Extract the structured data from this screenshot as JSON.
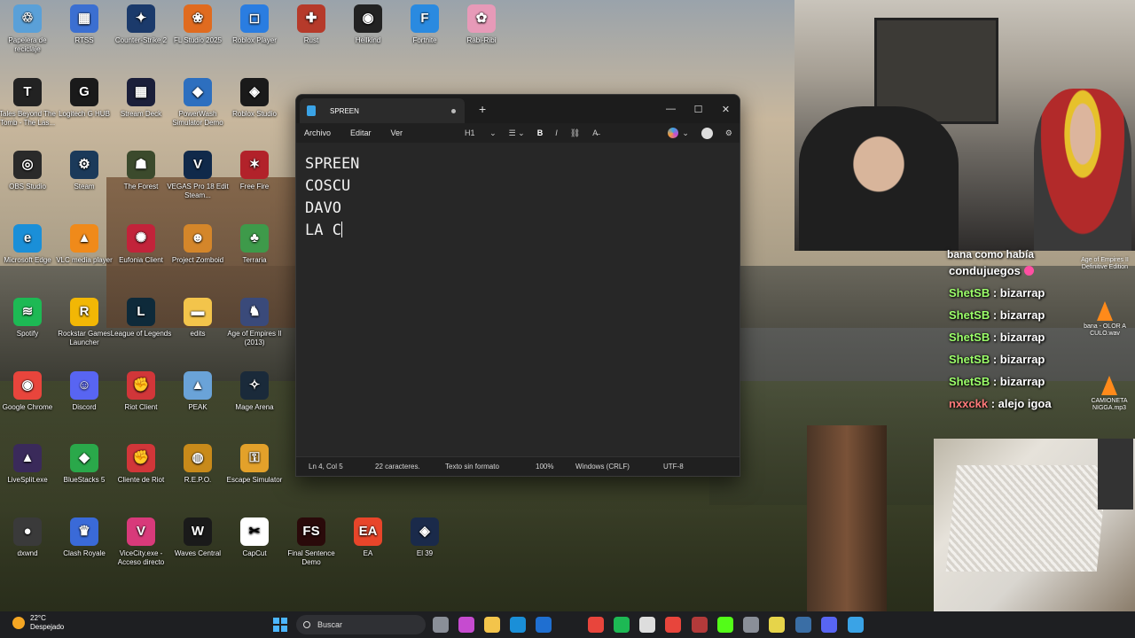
{
  "desktop_icons": [
    {
      "label": "Papelera de reciclaje",
      "icon": "recycle-bin-icon",
      "color": "#5aa0d8",
      "glyph": "♲"
    },
    {
      "label": "RTSS",
      "icon": "rtss-icon",
      "color": "#3b6fd1",
      "glyph": "▦"
    },
    {
      "label": "Counter-Strike 2",
      "icon": "counter-strike-icon",
      "color": "#1b3a6b",
      "glyph": "✦"
    },
    {
      "label": "FL Studio 2025",
      "icon": "fl-studio-icon",
      "color": "#e06b1f",
      "glyph": "❀"
    },
    {
      "label": "Roblox Player",
      "icon": "roblox-icon",
      "color": "#2a7de1",
      "glyph": "◻"
    },
    {
      "label": "Rust",
      "icon": "rust-icon",
      "color": "#b63a2a",
      "glyph": "✚"
    },
    {
      "label": "Hellkind",
      "icon": "hellkind-icon",
      "color": "#222222",
      "glyph": "◉"
    },
    {
      "label": "Fortnite",
      "icon": "fortnite-icon",
      "color": "#2a8ae0",
      "glyph": "F"
    },
    {
      "label": "Rabi-Ribi",
      "icon": "rabi-ribi-icon",
      "color": "#e79ab8",
      "glyph": "✿"
    },
    {
      "label": "Tales Beyond The Tomb - The Las...",
      "icon": "tbtt-icon",
      "color": "#222222",
      "glyph": "T"
    },
    {
      "label": "Logitech G HUB",
      "icon": "logitech-icon",
      "color": "#1a1a1a",
      "glyph": "G"
    },
    {
      "label": "Stream Deck",
      "icon": "stream-deck-icon",
      "color": "#1b1f3a",
      "glyph": "▦"
    },
    {
      "label": "PowerWash Simulator Demo",
      "icon": "powerwash-icon",
      "color": "#2d6fbf",
      "glyph": "◆"
    },
    {
      "label": "Roblox Studio",
      "icon": "roblox-studio-icon",
      "color": "#1a1a1a",
      "glyph": "◈"
    },
    {
      "label": "OBS Studio",
      "icon": "obs-icon",
      "color": "#2a2a2a",
      "glyph": "◎"
    },
    {
      "label": "Steam",
      "icon": "steam-icon",
      "color": "#1b3a5a",
      "glyph": "⚙"
    },
    {
      "label": "The Forest",
      "icon": "the-forest-icon",
      "color": "#3b4a2c",
      "glyph": "☗"
    },
    {
      "label": "VEGAS Pro 18 Edit Steam...",
      "icon": "vegas-pro-icon",
      "color": "#10294a",
      "glyph": "V"
    },
    {
      "label": "Free Fire",
      "icon": "free-fire-icon",
      "color": "#b2222a",
      "glyph": "✶"
    },
    {
      "label": "Microsoft Edge",
      "icon": "edge-icon",
      "color": "#1a8fd8",
      "glyph": "e"
    },
    {
      "label": "VLC media player",
      "icon": "vlc-icon",
      "color": "#f08a1a",
      "glyph": "▲"
    },
    {
      "label": "Eufonia Client",
      "icon": "eufonia-icon",
      "color": "#c2233a",
      "glyph": "✺"
    },
    {
      "label": "Project Zomboid",
      "icon": "zomboid-icon",
      "color": "#d4862a",
      "glyph": "☻"
    },
    {
      "label": "Terraria",
      "icon": "terraria-icon",
      "color": "#3e9a4a",
      "glyph": "♣"
    },
    {
      "label": "Spotify",
      "icon": "spotify-icon",
      "color": "#1db954",
      "glyph": "≋"
    },
    {
      "label": "Rockstar Games Launcher",
      "icon": "rockstar-icon",
      "color": "#f2b705",
      "glyph": "R"
    },
    {
      "label": "League of Legends",
      "icon": "league-icon",
      "color": "#0e2a3a",
      "glyph": "L"
    },
    {
      "label": "edits",
      "icon": "folder-icon",
      "color": "#f3c44b",
      "glyph": "▬"
    },
    {
      "label": "Age of Empires II (2013)",
      "icon": "age-of-empires-icon",
      "color": "#3a4a7a",
      "glyph": "♞"
    },
    {
      "label": "Google Chrome",
      "icon": "chrome-icon",
      "color": "#e8453c",
      "glyph": "◉"
    },
    {
      "label": "Discord",
      "icon": "discord-icon",
      "color": "#5865f2",
      "glyph": "☺"
    },
    {
      "label": "Riot Client",
      "icon": "riot-icon",
      "color": "#d13639",
      "glyph": "✊"
    },
    {
      "label": "PEAK",
      "icon": "peak-icon",
      "color": "#6aa3d8",
      "glyph": "▲"
    },
    {
      "label": "Mage Arena",
      "icon": "mage-arena-icon",
      "color": "#1a2a3a",
      "glyph": "✧"
    },
    {
      "label": "LiveSplit.exe",
      "icon": "livesplit-icon",
      "color": "#3a2a5a",
      "glyph": "▲"
    },
    {
      "label": "BlueStacks 5",
      "icon": "bluestacks-icon",
      "color": "#2aa84a",
      "glyph": "◆"
    },
    {
      "label": "Cliente de Riot",
      "icon": "riot-client-icon",
      "color": "#d13639",
      "glyph": "✊"
    },
    {
      "label": "R.E.P.O.",
      "icon": "repo-icon",
      "color": "#c88a1a",
      "glyph": "◍"
    },
    {
      "label": "Escape Simulator",
      "icon": "escape-sim-icon",
      "color": "#e3a12a",
      "glyph": "⚿"
    },
    {
      "label": "dxwnd",
      "icon": "dxwnd-icon",
      "color": "#3a3a3a",
      "glyph": "●"
    },
    {
      "label": "Clash Royale",
      "icon": "clash-royale-icon",
      "color": "#3a6ad8",
      "glyph": "♛"
    },
    {
      "label": "ViceCity.exe - Acceso directo",
      "icon": "vicecity-icon",
      "color": "#d83a7a",
      "glyph": "V"
    },
    {
      "label": "Waves Central",
      "icon": "waves-icon",
      "color": "#1a1a1a",
      "glyph": "W"
    },
    {
      "label": "CapCut",
      "icon": "capcut-icon",
      "color": "#ffffff",
      "glyph": "✂"
    },
    {
      "label": "Final Sentence Demo",
      "icon": "final-sentence-icon",
      "color": "#2a0a0a",
      "glyph": "FS"
    },
    {
      "label": "EA",
      "icon": "ea-icon",
      "color": "#e8452a",
      "glyph": "EA"
    },
    {
      "label": "El 39",
      "icon": "el39-icon",
      "color": "#1a2a4a",
      "glyph": "◈"
    }
  ],
  "notepad": {
    "tab_title": "SPREEN",
    "menu": [
      "Archivo",
      "Editar",
      "Ver"
    ],
    "heading_label": "H1",
    "lines": [
      "SPREEN",
      "COSCU",
      "DAVO",
      "LA C"
    ],
    "status": {
      "position": "Ln 4, Col 5",
      "chars": "22 caracteres.",
      "format": "Texto sin formato",
      "zoom": "100%",
      "eol": "Windows (CRLF)",
      "encoding": "UTF-8"
    }
  },
  "chat": {
    "top_line": "bana como había",
    "messages": [
      {
        "user": "condujuegos",
        "text": "",
        "heart": true
      },
      {
        "user": "ShetSB",
        "text": " : bizarrap"
      },
      {
        "user": "ShetSB",
        "text": " : bizarrap"
      },
      {
        "user": "ShetSB",
        "text": " : bizarrap"
      },
      {
        "user": "ShetSB",
        "text": " : bizarrap"
      },
      {
        "user": "ShetSB",
        "text": " : bizarrap"
      },
      {
        "user": "nxxckk",
        "text": " : alejo igoa"
      }
    ],
    "side_labels": [
      "Age of Empires II Definitive Edition",
      "bana - OLOR A CULO.wav",
      "CAMIONETA NIGGA.mp3"
    ]
  },
  "taskbar": {
    "temperature": "22°C",
    "weather": "Despejado",
    "search_placeholder": "Buscar",
    "colors": {
      "bg": "#1e1f22",
      "accent": "#4cb6ff"
    }
  }
}
